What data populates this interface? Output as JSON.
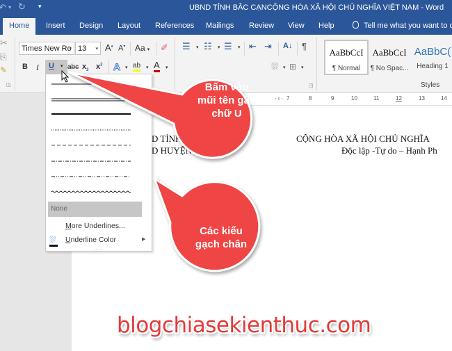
{
  "window": {
    "title": "UBND TỈNH BẮC CẠNCỘNG HÒA XÃ HỘI CHỦ NGHĨA VIỆT NAM  -  Word"
  },
  "quick_access": {
    "undo_icon": "undo-icon",
    "redo_icon": "redo-icon",
    "customize_icon": "customize-qat-icon"
  },
  "tabs": [
    {
      "label": "Home",
      "active": true
    },
    {
      "label": "Insert"
    },
    {
      "label": "Design"
    },
    {
      "label": "Layout"
    },
    {
      "label": "References"
    },
    {
      "label": "Mailings"
    },
    {
      "label": "Review"
    },
    {
      "label": "View"
    },
    {
      "label": "Help"
    }
  ],
  "tell_me": {
    "placeholder": "Tell me what you want to d"
  },
  "ribbon": {
    "font": {
      "name": "Times New Ro",
      "size": "13",
      "grow_label": "A",
      "shrink_label": "A",
      "case_label": "Aa",
      "bold": "B",
      "italic": "I",
      "underline": "U",
      "strikethrough": "abc",
      "subscript": "x",
      "superscript": "x",
      "text_effects": "A",
      "highlight": "ab",
      "font_color": "A",
      "font_color_hex": "#c00000",
      "highlight_color_hex": "#ffff00"
    },
    "paragraph": {
      "pilcrow": "¶",
      "sort": "A↓"
    },
    "styles": {
      "group_label": "Styles",
      "items": [
        {
          "preview": "AaBbCcI",
          "name": "¶ Normal",
          "selected": true
        },
        {
          "preview": "AaBbCcI",
          "name": "¶ No Spac..."
        },
        {
          "preview": "AaBbC(",
          "name": "Heading 1"
        }
      ]
    }
  },
  "ruler": {
    "ticks": [
      "7",
      "8",
      "9",
      "10",
      "11",
      "12",
      "13",
      "14"
    ]
  },
  "document": {
    "line1_left": "D TỈNH B",
    "line2_left": "D HUYỆN BA BE",
    "line1_right": "CỘNG HÒA XÃ HỘI CHỦ NGHĨA",
    "line2_right": "Độc lập -Tự do – Hạnh Ph"
  },
  "underline_menu": {
    "styles": [
      "single",
      "double",
      "thick",
      "dotted",
      "dashed",
      "dash-dot",
      "dash-dot-dot",
      "wave"
    ],
    "none_label": "None",
    "more_label": "More Underlines...",
    "more_accel": "M",
    "color_label": "Underline Color",
    "color_accel": "U"
  },
  "callouts": {
    "top": {
      "lines": [
        "Bấm vào",
        "mũi tên gần",
        "chữ U"
      ],
      "color": "#f04040"
    },
    "bottom": {
      "lines": [
        "Các kiểu",
        "gạch chân"
      ],
      "color": "#f04040"
    }
  },
  "watermark": "blogchiasekienthuc.com"
}
